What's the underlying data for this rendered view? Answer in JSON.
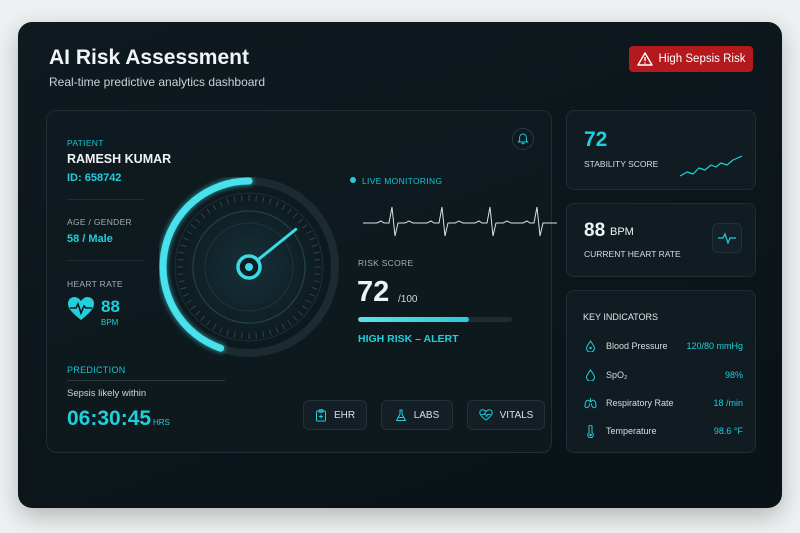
{
  "header": {
    "title": "AI Risk Assessment",
    "subtitle": "Real-time predictive analytics dashboard",
    "alert_badge": "High Sepsis Risk"
  },
  "patient": {
    "label": "PATIENT",
    "name": "RAMESH KUMAR",
    "id": "ID: 658742",
    "age_gender_label": "AGE / GENDER",
    "age_gender": "58 / Male",
    "heart_rate_label": "HEART RATE",
    "heart_rate_value": "88",
    "heart_rate_unit": "BPM"
  },
  "prediction": {
    "label": "PREDICTION",
    "text": "Sepsis likely within",
    "countdown": "06:30:45",
    "unit": "HRS"
  },
  "monitoring": {
    "label": "LIVE MONITORING"
  },
  "risk": {
    "label": "RISK SCORE",
    "value": "72",
    "max": "/100",
    "fraction": 0.72,
    "status": "HIGH RISK – ALERT"
  },
  "gauge": {
    "fraction": 0.72
  },
  "actions": [
    {
      "label": "EHR",
      "icon": "clipboard-icon"
    },
    {
      "label": "LABS",
      "icon": "flask-icon"
    },
    {
      "label": "VITALS",
      "icon": "heart-pulse-icon"
    }
  ],
  "stability": {
    "value": "72",
    "label": "STABILITY SCORE"
  },
  "current_hr": {
    "value": "88",
    "unit": "BPM",
    "label": "CURRENT HEART RATE"
  },
  "indicators": {
    "title": "KEY INDICATORS",
    "items": [
      {
        "name": "Blood Pressure",
        "value": "120/80 mmHg",
        "icon": "blood-drop-icon"
      },
      {
        "name": "SpO₂",
        "value": "98%",
        "icon": "oxygen-drop-icon"
      },
      {
        "name": "Respiratory Rate",
        "value": "18 /min",
        "icon": "lungs-icon"
      },
      {
        "name": "Temperature",
        "value": "98.6 °F",
        "icon": "thermometer-icon"
      }
    ]
  },
  "colors": {
    "accent": "#1fcfdb",
    "alert": "#b3191d",
    "background": "#0b151a"
  }
}
